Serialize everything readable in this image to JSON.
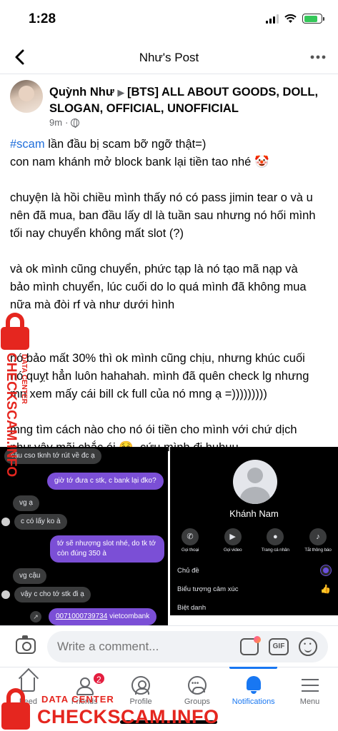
{
  "status_bar": {
    "time": "1:28"
  },
  "nav": {
    "title": "Như's Post",
    "back_icon": "chevron-left-icon",
    "more_icon": "more-horizontal-icon"
  },
  "post": {
    "author": "Quỳnh Như",
    "group": "[BTS] ALL ABOUT GOODS, DOLL, SLOGAN, OFFICIAL, UNOFFICIAL",
    "time": "9m",
    "privacy_icon": "globe-icon",
    "hashtag": "#scam",
    "paragraphs": {
      "p1_rest": " lần đầu bị scam bỡ ngỡ thật=)",
      "p2": "con nam khánh mở block bank lại tiền tao nhé 🤡",
      "p3": "chuyện là hồi chiều mình thấy nó có pass jimin tear o và u nên đã mua, ban đầu lấy dl là tuần sau nhưng nó hối mình tối nay chuyển không mất slot (?)",
      "p4": "và ok mình cũng chuyển, phức tạp là nó tạo mã nạp và bảo mình chuyển, lúc cuối do lo quá mình đã không mua nữa mà đòi rf và như dưới hình",
      "p5": "nó bảo mất 30% thì ok mình cũng chịu, nhưng khúc cuối nó quỵt hẳn luôn hahahah. mình đã quên check lg nhưng mn xem mấy cái bill ck full của nó mng ạ =)))))))))",
      "p6": "mng tìm cách nào cho nó ói tiền cho mình với chứ dịch như vậy mãi chắc ói ☺️, cứu mình đi huhuu"
    }
  },
  "chat_screenshot": {
    "messages": [
      {
        "side": "in",
        "text": "cậu cso tknh tớ rút về đc ạ"
      },
      {
        "side": "out",
        "text": "giờ tớ đưa c stk, c bank lại đko?"
      },
      {
        "side": "in",
        "text": "vg ạ"
      },
      {
        "side": "in",
        "text": "c có lấy ko à"
      },
      {
        "side": "out",
        "text": "tớ sẽ nhượng slot nhé, do tk tớ còn đúng 350 à"
      },
      {
        "side": "in",
        "text": "vg cậu"
      },
      {
        "side": "in",
        "text": "vậy c cho tớ stk đi ạ"
      }
    ],
    "account_number": "0071000739734",
    "bank_name": " vietcombank"
  },
  "profile_screenshot": {
    "name": "Khánh Nam",
    "actions": [
      {
        "icon": "phone-icon",
        "label": "Gọi thoại"
      },
      {
        "icon": "video-icon",
        "label": "Gọi video"
      },
      {
        "icon": "person-icon",
        "label": "Trang cá nhân"
      },
      {
        "icon": "bell-icon",
        "label": "Tắt thông báo"
      }
    ],
    "settings": [
      {
        "label": "Chủ đề",
        "icon": "theme-dot-icon"
      },
      {
        "label": "Biểu tượng cảm xúc",
        "icon": "thumbs-up-icon"
      },
      {
        "label": "Biệt danh",
        "icon": ""
      }
    ]
  },
  "comment_bar": {
    "placeholder": "Write a comment...",
    "camera_icon": "camera-icon",
    "sticker_icon": "avatar-sticker-icon",
    "gif_label": "GIF",
    "emoji_icon": "emoji-icon"
  },
  "tab_bar": {
    "items": [
      {
        "label": "Feed",
        "icon": "home-icon"
      },
      {
        "label": "Friends",
        "icon": "friends-icon",
        "badge": "2"
      },
      {
        "label": "Profile",
        "icon": "profile-icon"
      },
      {
        "label": "Groups",
        "icon": "groups-icon"
      },
      {
        "label": "Notifications",
        "icon": "bell-icon",
        "active": true
      },
      {
        "label": "Menu",
        "icon": "menu-icon"
      }
    ]
  },
  "watermark": {
    "small": "DATA CENTER",
    "big": "CHECKSCAM.INFO",
    "color": "#e5261f"
  },
  "colors": {
    "link_blue": "#216fdb",
    "active_blue": "#1877f2",
    "badge_red": "#e41e3f",
    "chat_outgoing": "#7b4fd6"
  }
}
